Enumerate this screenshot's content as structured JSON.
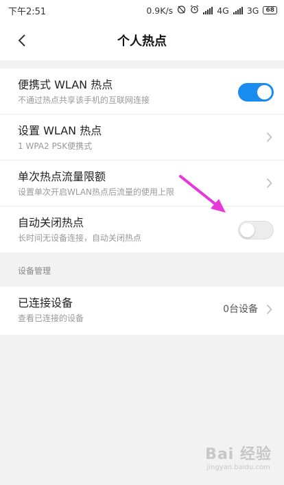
{
  "statusbar": {
    "time": "下午2:51",
    "speed": "0.9K/s",
    "net1": "4G",
    "net2": "3G",
    "battery": "68"
  },
  "header": {
    "title": "个人热点"
  },
  "settings": [
    {
      "title": "便携式 WLAN 热点",
      "subtitle": "不通过热点共享该手机的互联网连接",
      "control": "toggle",
      "on": true
    },
    {
      "title": "设置 WLAN 热点",
      "subtitle": "1 WPA2 PSK便携式",
      "control": "chevron"
    },
    {
      "title": "单次热点流量限额",
      "subtitle": "设置单次开启WLAN热点后流量的使用上限",
      "control": "chevron"
    },
    {
      "title": "自动关闭热点",
      "subtitle": "长时间无设备连接，自动关闭热点",
      "control": "toggle",
      "on": false
    }
  ],
  "device_section": {
    "label": "设备管理",
    "connected": {
      "title": "已连接设备",
      "subtitle": "查看已连接的设备",
      "value": "0台设备"
    }
  },
  "watermark": {
    "brand": "Bai 经验",
    "url": "jingyan.baidu.com"
  },
  "colors": {
    "accent": "#1a8cf0",
    "annotation": "#e838d8"
  }
}
